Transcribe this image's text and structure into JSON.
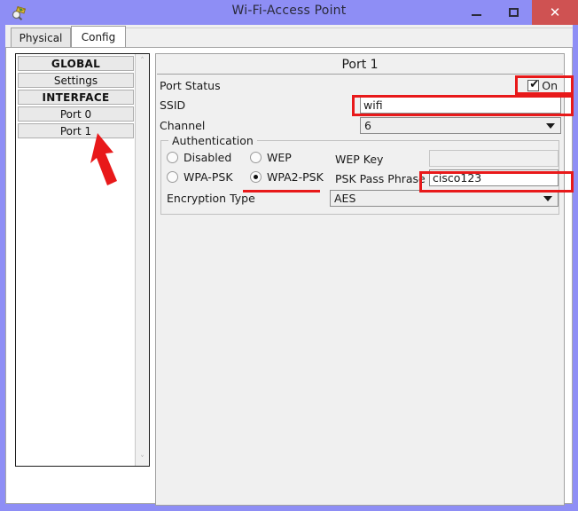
{
  "window": {
    "title": "Wi-Fi-Access Point",
    "icon": "packet-tracer-icon",
    "minimize_label": "–",
    "maximize_label": "□",
    "close_label": "✕"
  },
  "tabs": [
    {
      "label": "Physical",
      "active": false
    },
    {
      "label": "Config",
      "active": true
    }
  ],
  "sidebar": {
    "items": [
      {
        "label": "GLOBAL",
        "type": "header"
      },
      {
        "label": "Settings",
        "type": "item"
      },
      {
        "label": "INTERFACE",
        "type": "header"
      },
      {
        "label": "Port 0",
        "type": "item"
      },
      {
        "label": "Port 1",
        "type": "item"
      }
    ],
    "scrollbar": {
      "up": "˄",
      "down": "˅"
    }
  },
  "panel": {
    "title": "Port 1",
    "port_status": {
      "label": "Port Status",
      "checked": true,
      "check_glyph": "✔",
      "on_label": "On"
    },
    "ssid": {
      "label": "SSID",
      "value": "wifi",
      "placeholder": ""
    },
    "channel": {
      "label": "Channel",
      "value": "6"
    },
    "authentication": {
      "legend": "Authentication",
      "options": [
        {
          "label": "Disabled",
          "selected": false
        },
        {
          "label": "WEP",
          "selected": false
        },
        {
          "label": "WPA-PSK",
          "selected": false
        },
        {
          "label": "WPA2-PSK",
          "selected": true
        }
      ],
      "wep_key": {
        "label": "WEP Key",
        "value": "",
        "disabled": true
      },
      "psk_pass_phrase": {
        "label": "PSK Pass Phrase",
        "value": "cisco123"
      },
      "encryption_type": {
        "label": "Encryption Type",
        "value": "AES"
      }
    }
  },
  "annotations": {
    "accent_color": "#e8191a",
    "arrow": "red-arrow-pointing-to-port-1",
    "highlights": [
      "port-status-checkbox",
      "ssid-field",
      "wpa2-psk-radio",
      "psk-pass-phrase-field"
    ]
  },
  "colors": {
    "titlebar": "#8e8ef5",
    "close_button": "#cf5252",
    "panel_bg": "#f0f0f0",
    "accent": "#e8191a"
  }
}
